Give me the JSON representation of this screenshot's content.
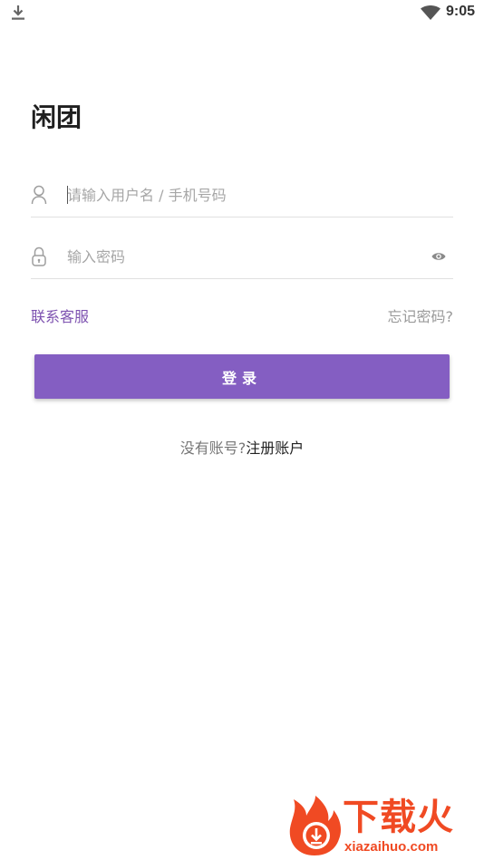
{
  "status_bar": {
    "time": "9:05",
    "icons": [
      "download-icon",
      "wifi-icon"
    ]
  },
  "app": {
    "title": "闲团"
  },
  "login_form": {
    "username": {
      "value": "",
      "placeholder": "请输入用户名 / 手机号码",
      "icon": "user-icon"
    },
    "password": {
      "value": "",
      "placeholder": "输入密码",
      "icon": "lock-icon",
      "toggle_icon": "eye-icon"
    },
    "contact_label": "联系客服",
    "forgot_label": "忘记密码?",
    "login_label": "登录",
    "register_prompt": "没有账号?",
    "register_label": "注册账户"
  },
  "watermark": {
    "title": "下载火",
    "url": "xiazaihuo.com"
  },
  "colors": {
    "accent": "#845ec2",
    "link": "#7d52b0",
    "watermark": "#f04a23"
  }
}
